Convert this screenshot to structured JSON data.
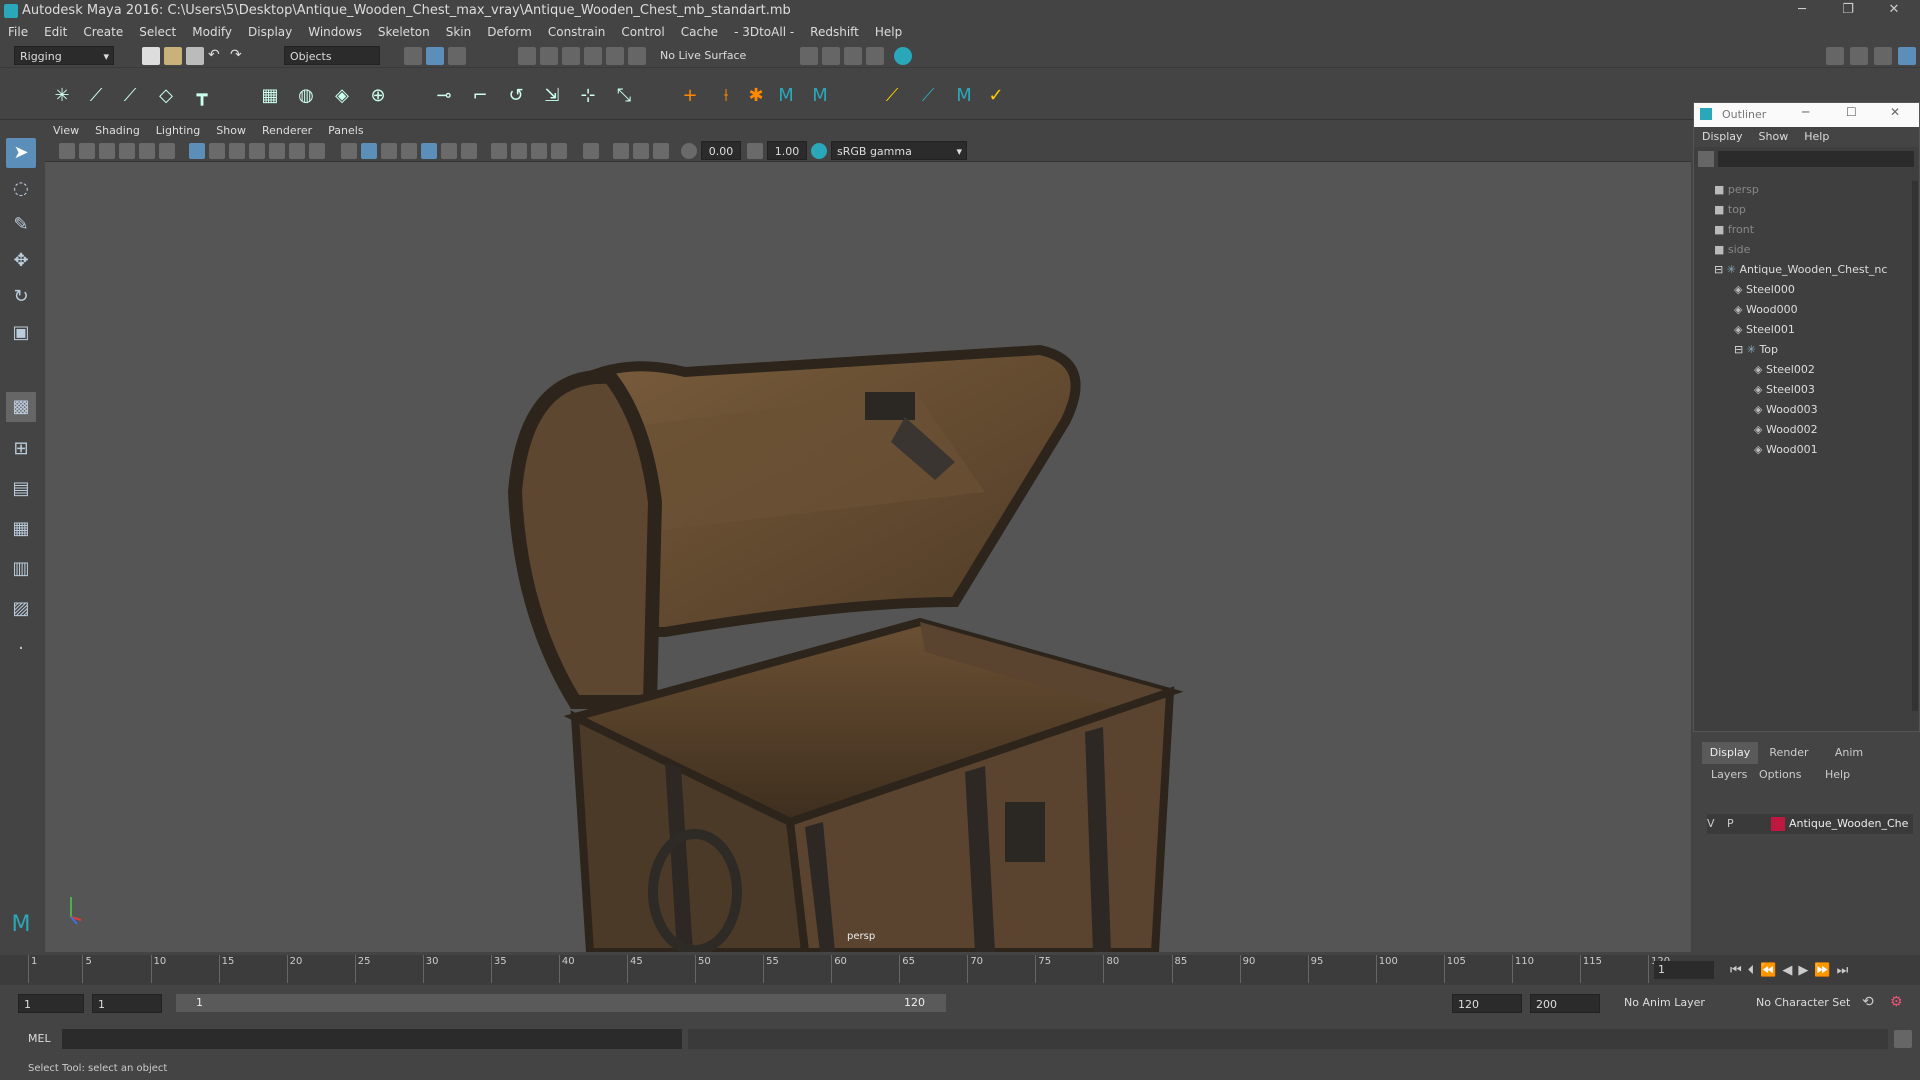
{
  "window": {
    "title": "Autodesk Maya 2016: C:\\Users\\5\\Desktop\\Antique_Wooden_Chest_max_vray\\Antique_Wooden_Chest_mb_standart.mb",
    "minimize": "─",
    "maximize": "❐",
    "close": "✕"
  },
  "menubar": [
    "File",
    "Edit",
    "Create",
    "Select",
    "Modify",
    "Display",
    "Windows",
    "Skeleton",
    "Skin",
    "Deform",
    "Constrain",
    "Control",
    "Cache",
    "- 3DtoAll -",
    "Redshift",
    "Help"
  ],
  "statusline": {
    "menuset": "Rigging",
    "selection_mode": "Objects",
    "live_surface": "No Live Surface"
  },
  "viewport": {
    "menu": [
      "View",
      "Shading",
      "Lighting",
      "Show",
      "Renderer",
      "Panels"
    ],
    "exposure": "0.00",
    "gamma": "1.00",
    "colorspace": "sRGB gamma",
    "camera_label": "persp"
  },
  "outliner": {
    "title": "Outliner",
    "menu": [
      "Display",
      "Show",
      "Help"
    ],
    "items": [
      {
        "label": "persp",
        "indent": 0,
        "kind": "camera",
        "dim": true
      },
      {
        "label": "top",
        "indent": 0,
        "kind": "camera",
        "dim": true
      },
      {
        "label": "front",
        "indent": 0,
        "kind": "camera",
        "dim": true
      },
      {
        "label": "side",
        "indent": 0,
        "kind": "camera",
        "dim": true
      },
      {
        "label": "Antique_Wooden_Chest_nc",
        "indent": 0,
        "kind": "group",
        "expanded": true
      },
      {
        "label": "Steel000",
        "indent": 1,
        "kind": "mesh"
      },
      {
        "label": "Wood000",
        "indent": 1,
        "kind": "mesh"
      },
      {
        "label": "Steel001",
        "indent": 1,
        "kind": "mesh"
      },
      {
        "label": "Top",
        "indent": 1,
        "kind": "group",
        "expanded": true
      },
      {
        "label": "Steel002",
        "indent": 2,
        "kind": "mesh"
      },
      {
        "label": "Steel003",
        "indent": 2,
        "kind": "mesh"
      },
      {
        "label": "Wood003",
        "indent": 2,
        "kind": "mesh"
      },
      {
        "label": "Wood002",
        "indent": 2,
        "kind": "mesh"
      },
      {
        "label": "Wood001",
        "indent": 2,
        "kind": "mesh"
      }
    ]
  },
  "layers": {
    "tabs": [
      "Display",
      "Render",
      "Anim"
    ],
    "menu": [
      "Layers",
      "Options",
      "Help"
    ],
    "row": {
      "v": "V",
      "p": "P",
      "name": "Antique_Wooden_Che",
      "color": "#c0173f"
    }
  },
  "timeline": {
    "ticks": [
      1,
      5,
      10,
      15,
      20,
      25,
      30,
      35,
      40,
      45,
      50,
      55,
      60,
      65,
      70,
      75,
      80,
      85,
      90,
      95,
      100,
      105,
      110,
      115,
      120
    ],
    "current_frame": "1"
  },
  "range": {
    "start": "1",
    "playback_start": "1",
    "slider_start": "1",
    "slider_end": "120",
    "playback_end": "120",
    "end": "200",
    "anim_layer": "No Anim Layer",
    "character_set": "No Character Set"
  },
  "cmdline": {
    "label": "MEL"
  },
  "helpline": "Select Tool: select an object"
}
